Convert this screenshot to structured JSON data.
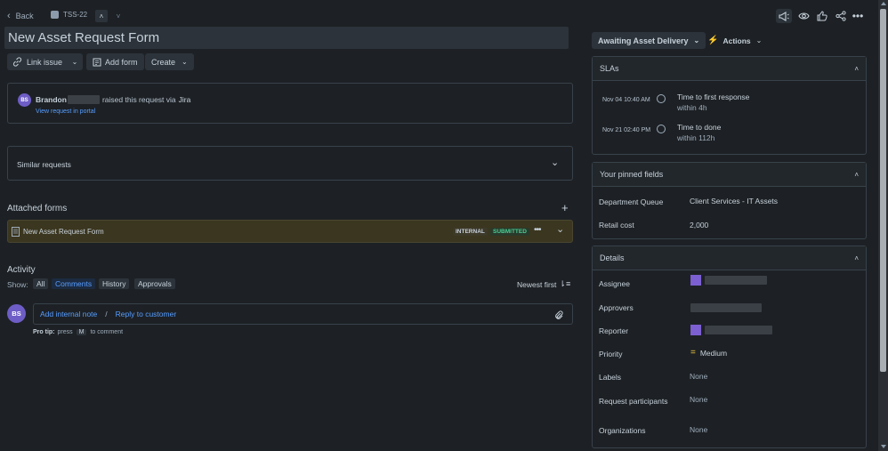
{
  "topbar": {
    "back_label": "Back",
    "issue_key": "TSS-22"
  },
  "issue": {
    "title": "New Asset Request Form"
  },
  "toolbar": {
    "link_issue_label": "Link issue",
    "add_form_label": "Add form",
    "create_label": "Create"
  },
  "requester": {
    "initials": "BS",
    "name": "Brandon",
    "raised_text": "raised this request via",
    "channel": "Jira",
    "view_portal_label": "View request in portal"
  },
  "similar_requests": {
    "label": "Similar requests"
  },
  "attached_forms": {
    "heading": "Attached forms",
    "form_name": "New Asset Request Form",
    "internal_label": "INTERNAL",
    "submitted_label": "SUBMITTED"
  },
  "activity": {
    "heading": "Activity",
    "show_label": "Show:",
    "filters": [
      "All",
      "Comments",
      "History",
      "Approvals"
    ],
    "sort_label": "Newest first",
    "commenter_initials": "BS",
    "add_note_label": "Add internal note",
    "separator": "/",
    "reply_label": "Reply to customer",
    "protip_prefix": "Pro tip:",
    "protip_press": "press",
    "protip_key": "M",
    "protip_suffix": "to comment"
  },
  "status": {
    "label": "Awaiting Asset Delivery",
    "actions_label": "Actions"
  },
  "slas": {
    "heading": "SLAs",
    "items": [
      {
        "date": "Nov 04 10:40 AM",
        "title": "Time to first response",
        "target": "within 4h"
      },
      {
        "date": "Nov 21 02:40 PM",
        "title": "Time to done",
        "target": "within 112h"
      }
    ]
  },
  "pinned": {
    "heading": "Your pinned fields",
    "fields": [
      {
        "label": "Department Queue",
        "value": "Client Services - IT Assets"
      },
      {
        "label": "Retail cost",
        "value": "2,000"
      }
    ]
  },
  "details": {
    "heading": "Details",
    "assignee_label": "Assignee",
    "approvers_label": "Approvers",
    "reporter_label": "Reporter",
    "priority_label": "Priority",
    "priority_value": "Medium",
    "labels_label": "Labels",
    "labels_value": "None",
    "participants_label": "Request participants",
    "participants_value": "None",
    "organizations_label": "Organizations",
    "organizations_value": "None"
  },
  "colors": {
    "background": "#1d2125",
    "link": "#579dff",
    "submitted_green": "#4bce97",
    "avatar_purple": "#7c5fd1",
    "priority_orange": "#f5cd47"
  }
}
